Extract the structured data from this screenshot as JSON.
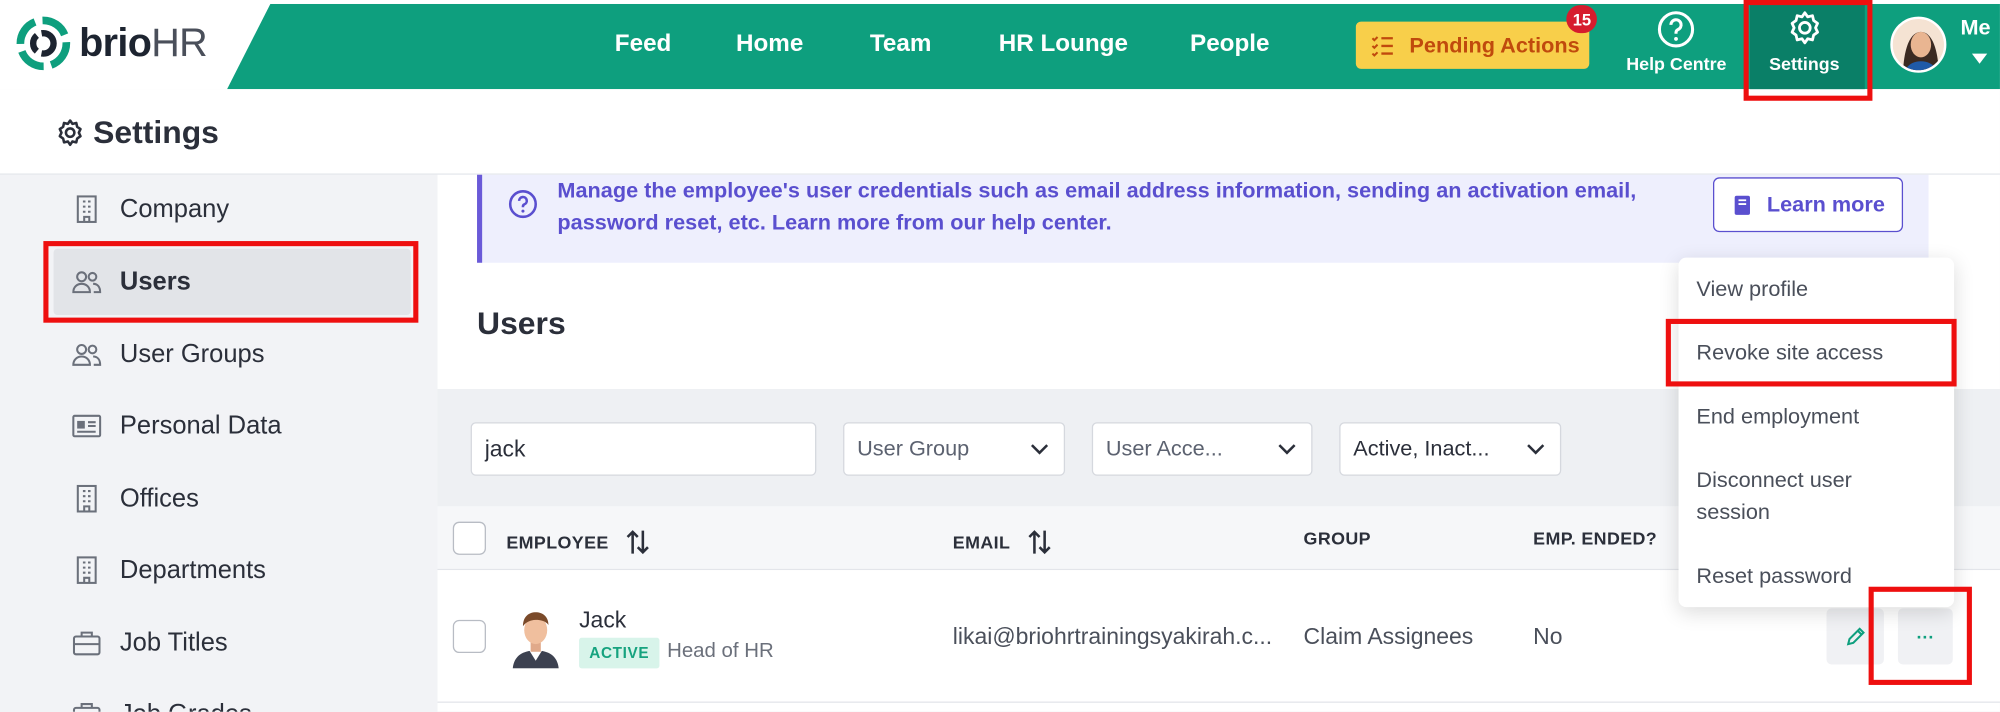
{
  "header": {
    "logo_brand": "brio",
    "logo_suffix": "HR",
    "nav": [
      "Feed",
      "Home",
      "Team",
      "HR Lounge",
      "People"
    ],
    "pending_label": "Pending Actions",
    "pending_count": "15",
    "help_label": "Help Centre",
    "settings_label": "Settings",
    "me_label": "Me"
  },
  "page": {
    "title": "Settings"
  },
  "sidebar": {
    "items": [
      {
        "label": "Company",
        "icon": "building-icon"
      },
      {
        "label": "Users",
        "icon": "users-icon"
      },
      {
        "label": "User Groups",
        "icon": "users-icon"
      },
      {
        "label": "Personal Data",
        "icon": "id-card-icon"
      },
      {
        "label": "Offices",
        "icon": "building-icon"
      },
      {
        "label": "Departments",
        "icon": "building-icon"
      },
      {
        "label": "Job Titles",
        "icon": "briefcase-icon"
      },
      {
        "label": "Job Grades",
        "icon": "briefcase-icon"
      }
    ]
  },
  "info": {
    "text": "Manage the employee's user credentials such as email address information, sending an activation email, password reset, etc. Learn more from our help center.",
    "learn_more": "Learn more"
  },
  "users": {
    "title": "Users",
    "search_value": "jack",
    "filters": [
      "User Group",
      "User Acce...",
      "Active, Inact..."
    ],
    "columns": [
      "EMPLOYEE",
      "EMAIL",
      "GROUP",
      "EMP. ENDED?"
    ],
    "rows": [
      {
        "name": "Jack",
        "status": "ACTIVE",
        "title": "Head of HR",
        "email": "likai@briohrtrainingsyakirah.c...",
        "group": "Claim Assignees",
        "ended": "No"
      }
    ],
    "more_label": "···"
  },
  "menu": {
    "items": [
      "View profile",
      "Revoke site access",
      "End employment",
      "Disconnect user session",
      "Reset password"
    ]
  },
  "colors": {
    "brand_green": "#0e9f7e",
    "pending_yellow": "#f8cf4a",
    "info_purple": "#5a4fcf",
    "highlight_red": "#ee0f0f"
  }
}
